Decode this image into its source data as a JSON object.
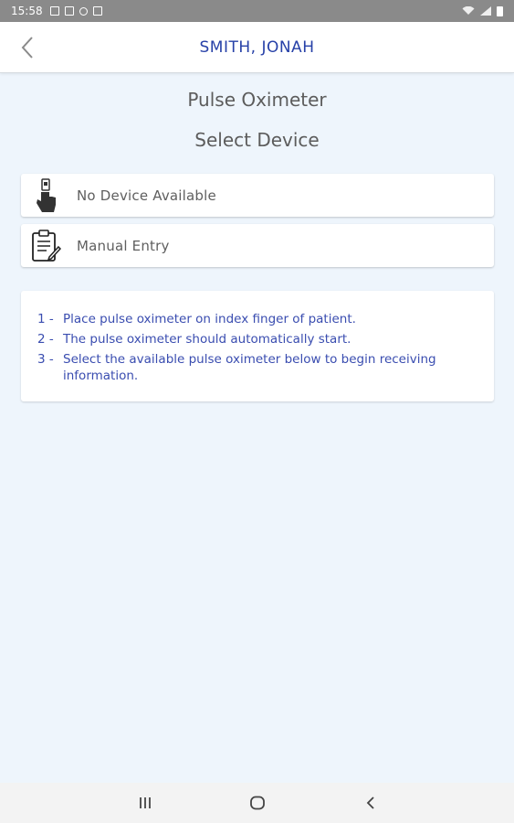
{
  "status_bar": {
    "time": "15:58",
    "left_icons": [
      "gallery-icon",
      "image-icon",
      "location-icon",
      "calendar-icon"
    ],
    "right_icons": [
      "wifi-icon",
      "signal-icon",
      "battery-icon"
    ]
  },
  "header": {
    "back_icon": "chevron-left-icon",
    "title": "SMITH, JONAH"
  },
  "screen": {
    "title": "Pulse Oximeter",
    "subtitle": "Select Device"
  },
  "options": [
    {
      "icon": "finger-oximeter-icon",
      "label": "No Device Available"
    },
    {
      "icon": "clipboard-edit-icon",
      "label": "Manual Entry"
    }
  ],
  "instructions": [
    {
      "num": "1 -",
      "text": "Place pulse oximeter on index finger of patient."
    },
    {
      "num": "2 -",
      "text": "The pulse oximeter should automatically start."
    },
    {
      "num": "3 -",
      "text": "Select the available pulse oximeter below to begin receiving information."
    }
  ],
  "nav_bar": {
    "buttons": [
      "recents-icon",
      "home-icon",
      "back-icon"
    ]
  },
  "colors": {
    "accent": "#2741a8",
    "instructions_text": "#3a4db0",
    "background": "#eef5fc",
    "status_bar": "#8a8a8a"
  }
}
